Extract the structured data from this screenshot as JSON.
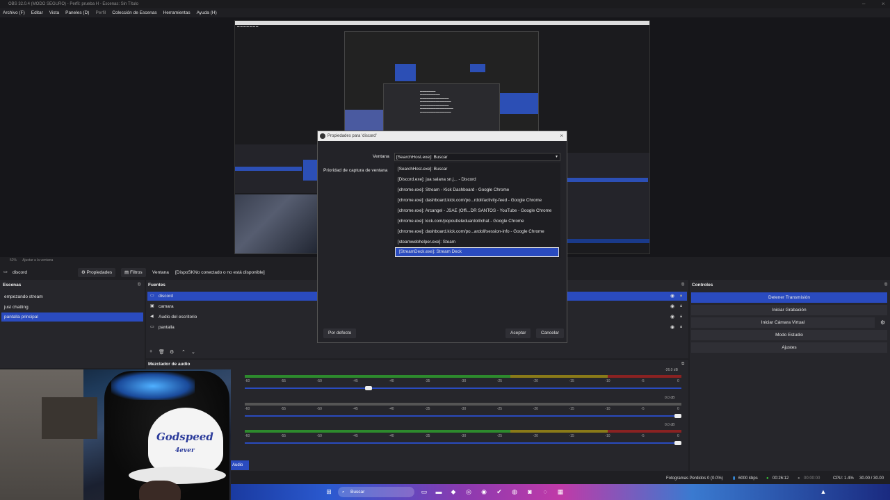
{
  "window": {
    "title": "OBS 32.0.4 (MODO SEGURO) - Perfil: prueba H - Escenas: Sin Título"
  },
  "menu": [
    "Archivo (F)",
    "Editar",
    "Vista",
    "Paneles (D)",
    "Perfil",
    "Colección de Escenas",
    "Herramientas",
    "Ayuda (H)"
  ],
  "preview": {
    "zoom_label": "52%",
    "fit_label": "Ajustar a la ventana"
  },
  "context_bar": {
    "source_name": "discord",
    "properties_label": "Propiedades",
    "filters_label": "Filtros",
    "window_label": "Ventana",
    "window_value": "[DispoSKNo conectado o no está disponible]"
  },
  "scenes": {
    "title": "Escenas",
    "items": [
      "empezando stream",
      "just chatting",
      "pantalla principal"
    ],
    "selected_index": 2
  },
  "sources": {
    "title": "Fuentes",
    "items": [
      {
        "name": "discord",
        "icon": "window-icon"
      },
      {
        "name": "camara",
        "icon": "camera-icon"
      },
      {
        "name": "Audio del escritorio",
        "icon": "speaker-icon"
      },
      {
        "name": "pantalla",
        "icon": "monitor-icon"
      }
    ],
    "selected_index": 0
  },
  "mixer": {
    "title": "Mezclador de audio",
    "tick_labels": [
      "-60",
      "-55",
      "-50",
      "-45",
      "-40",
      "-35",
      "-30",
      "-25",
      "-20",
      "-15",
      "-10",
      "-5",
      "0"
    ],
    "channels": [
      {
        "db": "-26.0 dB",
        "level": 0.28
      },
      {
        "db": "0.0 dB",
        "level": 1.0
      },
      {
        "db": "0.0 dB",
        "level": 1.0
      }
    ],
    "tag": "Audio"
  },
  "controls": {
    "title": "Controles",
    "buttons": [
      "Detener Transmisión",
      "Iniciar Grabación",
      "Iniciar Cámara Virtual",
      "Modo Estudio",
      "Ajustes"
    ],
    "active_index": 0
  },
  "dialog": {
    "title": "Propiedades para 'discord'",
    "window_label": "Ventana",
    "priority_label": "Prioridad de captura de ventana",
    "combo_value": "[SearchHost.exe]: Buscar",
    "options": [
      "[SearchHost.exe]: Buscar",
      "[Discord.exe]: jua salana sn.j... - Discord",
      "[chrome.exe]: Stream - Kick Dashboard - Google Chrome",
      "[chrome.exe]: dashboard.kick.com/po...rdoll/activity-feed - Google Chrome",
      "[chrome.exe]: Arcangel - JSAE (Offi...DR SANTOS - YouTube - Google Chrome",
      "[chrome.exe]: kick.com/popout/eleduardoll/chat - Google Chrome",
      "[chrome.exe]: dashboard.kick.com/po...ardoll/session-info - Google Chrome",
      "[steamwebhelper.exe]: Steam",
      "[StreamDeck.exe]: Stream Deck"
    ],
    "selected_index": 8,
    "defaults_label": "Por defecto",
    "ok_label": "Aceptar",
    "cancel_label": "Cancelar"
  },
  "status": {
    "dropped_frames": "Fotogramas Perdidos 0 (0.0%)",
    "bitrate": "6000 kbps",
    "stream_time": "00:26:12",
    "rec_time": "00:00:00",
    "cpu": "CPU: 1.4%",
    "fps": "30.00 / 30.00 FPS"
  },
  "taskbar": {
    "search_label": "Buscar"
  },
  "webcam": {
    "cap_text": "Godspeed",
    "cap_subtext": "4ever"
  }
}
